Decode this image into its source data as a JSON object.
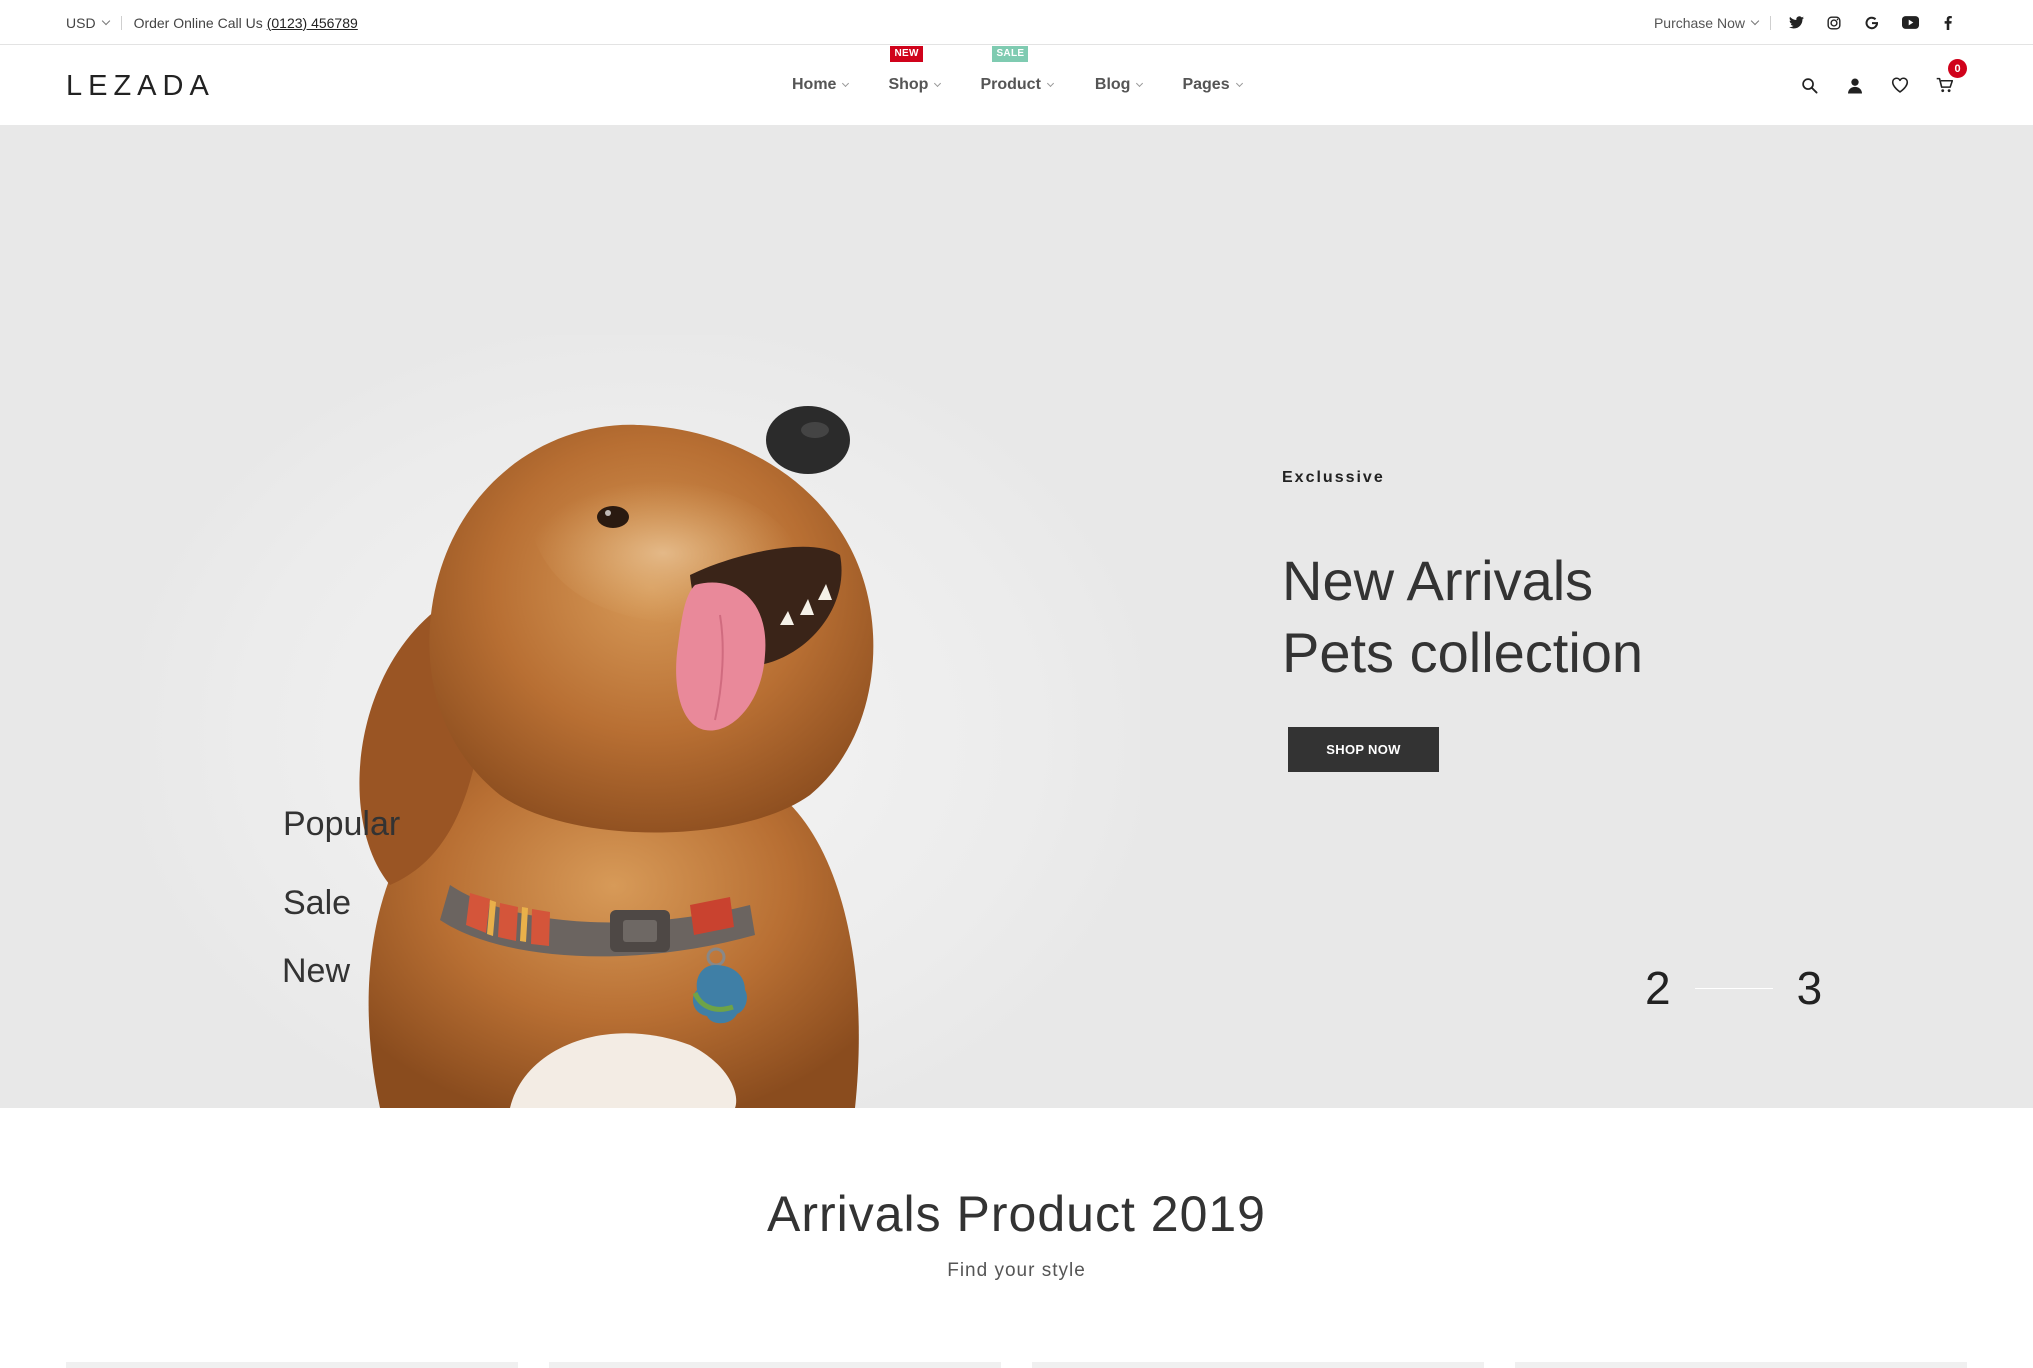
{
  "topbar": {
    "currency": "USD",
    "order_text": "Order Online Call Us",
    "phone": "(0123) 456789",
    "purchase": "Purchase Now",
    "social_icons": [
      "twitter-icon",
      "instagram-icon",
      "google-icon",
      "youtube-icon",
      "facebook-icon"
    ]
  },
  "header": {
    "logo": "LEZADA",
    "nav": [
      {
        "label": "Home"
      },
      {
        "label": "Shop",
        "badge": "NEW"
      },
      {
        "label": "Product",
        "badge": "SALE"
      },
      {
        "label": "Blog"
      },
      {
        "label": "Pages"
      }
    ],
    "icons": [
      "search-icon",
      "user-icon",
      "heart-icon",
      "cart-icon"
    ],
    "cart_count": "0"
  },
  "hero": {
    "categories": [
      "Popular",
      "Sale",
      "New"
    ],
    "eyebrow": "Exclussive",
    "title_line1": "New Arrivals",
    "title_line2": "Pets collection",
    "button": "SHOP NOW",
    "pager": {
      "current": "2",
      "next": "3"
    }
  },
  "section": {
    "title": "Arrivals Product 2019",
    "subtitle": "Find your style"
  },
  "colors": {
    "accent_new": "#d0021b",
    "accent_sale": "#7fcbb1",
    "hero_bg": "#e8e8e8",
    "button_bg": "#333333"
  }
}
